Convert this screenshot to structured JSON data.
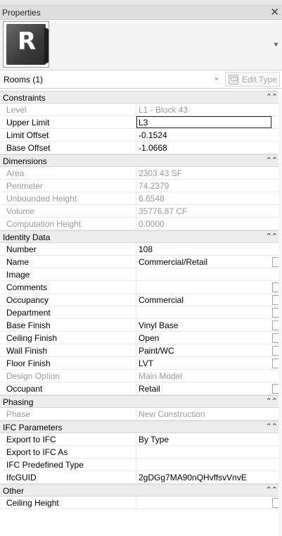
{
  "window": {
    "title": "Properties",
    "close_glyph": "✕"
  },
  "preview": {
    "logo_letter": "R",
    "scroll_glyph": "▼"
  },
  "type_selector": {
    "value": "Rooms (1)",
    "chevron": "⌄",
    "edit_type_label": "Edit Type"
  },
  "collapse_glyph": "⌃⌃",
  "sections": [
    {
      "title": "Constraints",
      "rows": [
        {
          "label": "Level",
          "value": "L1 - Block 43",
          "readonly": true
        },
        {
          "label": "Upper Limit",
          "value": "L3",
          "editing": true
        },
        {
          "label": "Limit Offset",
          "value": "-0.1524"
        },
        {
          "label": "Base Offset",
          "value": "-1.0668"
        }
      ]
    },
    {
      "title": "Dimensions",
      "rows": [
        {
          "label": "Area",
          "value": "2303.43 SF",
          "readonly": true
        },
        {
          "label": "Perimeter",
          "value": "74.2379",
          "readonly": true
        },
        {
          "label": "Unbounded Height",
          "value": "6.6548",
          "readonly": true
        },
        {
          "label": "Volume",
          "value": "35776.87 CF",
          "readonly": true
        },
        {
          "label": "Computation Height",
          "value": "0.0000",
          "readonly": true
        }
      ]
    },
    {
      "title": "Identity Data",
      "rows": [
        {
          "label": "Number",
          "value": "108"
        },
        {
          "label": "Name",
          "value": "Commercial/Retail",
          "button": true
        },
        {
          "label": "Image",
          "value": ""
        },
        {
          "label": "Comments",
          "value": "",
          "button": true
        },
        {
          "label": "Occupancy",
          "value": "Commercial",
          "button": true
        },
        {
          "label": "Department",
          "value": "",
          "button": true
        },
        {
          "label": "Base Finish",
          "value": "Vinyl Base",
          "button": true
        },
        {
          "label": "Ceiling Finish",
          "value": "Open",
          "button": true
        },
        {
          "label": "Wall Finish",
          "value": "Paint/WC",
          "button": true
        },
        {
          "label": "Floor Finish",
          "value": "LVT",
          "button": true
        },
        {
          "label": "Design Option",
          "value": "Main Model",
          "readonly": true
        },
        {
          "label": "Occupant",
          "value": "Retail",
          "button": true
        }
      ]
    },
    {
      "title": "Phasing",
      "rows": [
        {
          "label": "Phase",
          "value": "New Construction",
          "readonly": true
        }
      ]
    },
    {
      "title": "IFC Parameters",
      "rows": [
        {
          "label": "Export to IFC",
          "value": "By Type"
        },
        {
          "label": "Export to IFC As",
          "value": ""
        },
        {
          "label": "IFC Predefined Type",
          "value": ""
        },
        {
          "label": "IfcGUID",
          "value": "2gDGg7MA90nQHvffsvVnvE"
        }
      ]
    },
    {
      "title": "Other",
      "rows": [
        {
          "label": "Ceiling Height",
          "value": "",
          "button": true
        }
      ]
    }
  ]
}
